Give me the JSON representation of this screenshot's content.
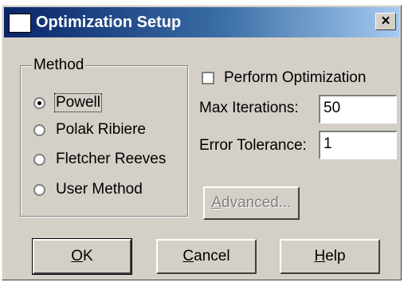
{
  "window": {
    "title": "Optimization Setup",
    "close_glyph": "×",
    "icon": "app-window-icon"
  },
  "method": {
    "legend": "Method",
    "options": [
      {
        "label": "Powell",
        "selected": true
      },
      {
        "label": "Polak Ribiere",
        "selected": false
      },
      {
        "label": "Fletcher Reeves",
        "selected": false
      },
      {
        "label": "User Method",
        "selected": false
      }
    ]
  },
  "perform_optimization": {
    "label": "Perform Optimization",
    "checked": false
  },
  "fields": {
    "max_iterations": {
      "label": "Max Iterations:",
      "value": "50"
    },
    "error_tolerance": {
      "label": "Error Tolerance:",
      "value": "1"
    }
  },
  "buttons": {
    "advanced": {
      "first": "A",
      "rest": "dvanced...",
      "enabled": false
    },
    "ok": {
      "first": "O",
      "rest": "K"
    },
    "cancel": {
      "first": "C",
      "rest": "ancel"
    },
    "help": {
      "first": "H",
      "rest": "elp"
    }
  },
  "colors": {
    "face": "#d4d0c8",
    "title_start": "#0a246a",
    "title_end": "#a6caf0"
  }
}
